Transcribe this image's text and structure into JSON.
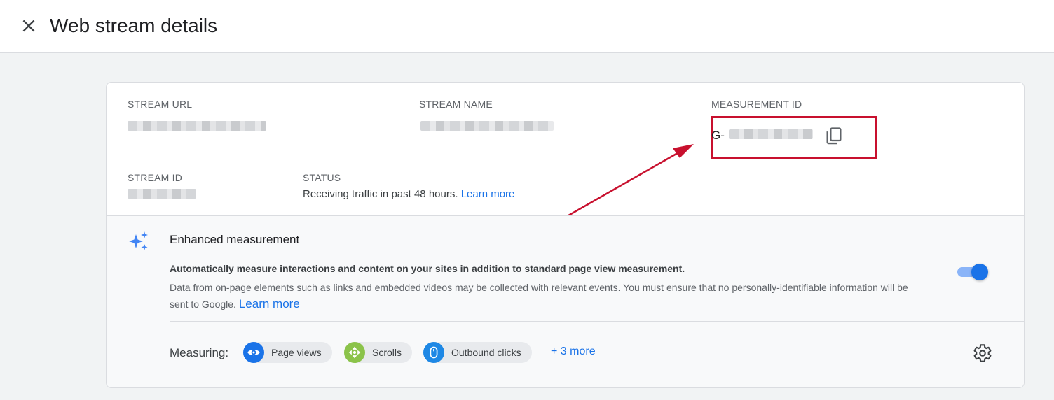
{
  "header": {
    "title": "Web stream details"
  },
  "stream": {
    "url_label": "STREAM URL",
    "name_label": "STREAM NAME",
    "measurement_label": "MEASUREMENT ID",
    "measurement_prefix": "G-",
    "id_label": "STREAM ID",
    "status_label": "STATUS",
    "status_text": "Receiving traffic in past 48 hours.",
    "status_link": "Learn more"
  },
  "enhanced": {
    "title": "Enhanced measurement",
    "bold_text": "Automatically measure interactions and content on your sites in addition to standard page view measurement.",
    "description": "Data from on-page elements such as links and embedded videos may be collected with relevant events. You must ensure that no personally-identifiable information will be sent to Google.",
    "learn_more": "Learn more",
    "enabled": true,
    "measuring_label": "Measuring:",
    "chips": [
      {
        "label": "Page views",
        "icon": "eye-icon",
        "color": "#1a73e8"
      },
      {
        "label": "Scrolls",
        "icon": "scroll-arrows-icon",
        "color": "#8bc34a"
      },
      {
        "label": "Outbound clicks",
        "icon": "mouse-icon",
        "color": "#1e88e5"
      }
    ],
    "more_link": "+ 3 more"
  },
  "colors": {
    "accent": "#1a73e8",
    "highlight": "#c8102e"
  }
}
